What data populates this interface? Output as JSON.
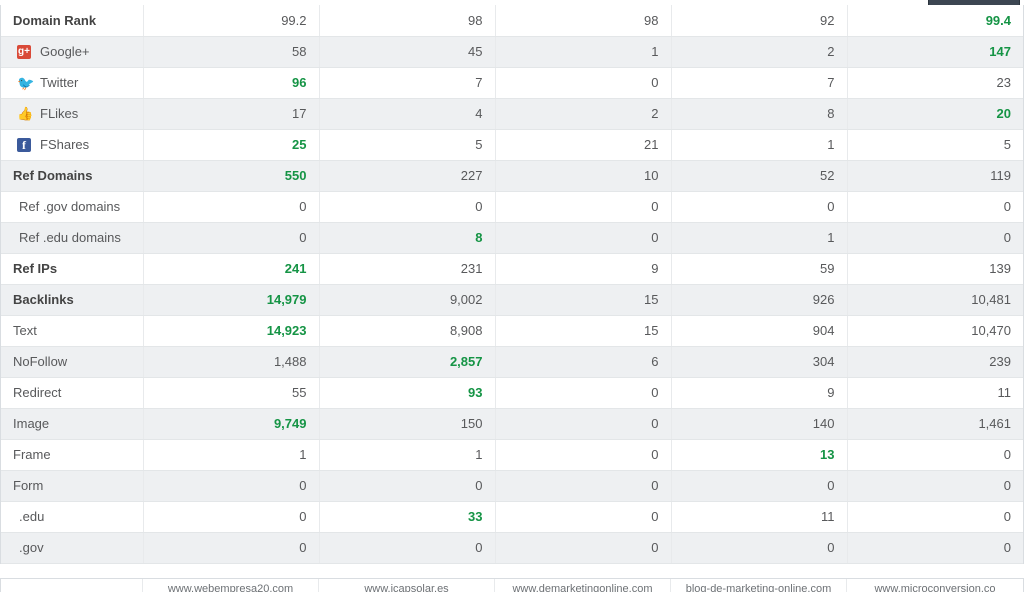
{
  "table": {
    "columns": [
      "metric",
      "site1",
      "site2",
      "site3",
      "site4",
      "site5"
    ],
    "rows": [
      {
        "label": "Domain Rank",
        "style": "head",
        "shade": false,
        "icon": null,
        "values": [
          {
            "text": "99.2",
            "green": false
          },
          {
            "text": "98",
            "green": false
          },
          {
            "text": "98",
            "green": false
          },
          {
            "text": "92",
            "green": false
          },
          {
            "text": "99.4",
            "green": true
          }
        ]
      },
      {
        "label": "Google+",
        "style": "social",
        "shade": true,
        "icon": "google-plus-icon",
        "icon_glyph": "g+",
        "values": [
          {
            "text": "58",
            "green": false
          },
          {
            "text": "45",
            "green": false
          },
          {
            "text": "1",
            "green": false
          },
          {
            "text": "2",
            "green": false
          },
          {
            "text": "147",
            "green": true
          }
        ]
      },
      {
        "label": "Twitter",
        "style": "social",
        "shade": false,
        "icon": "twitter-bird-icon",
        "icon_glyph": "ὂ6",
        "values": [
          {
            "text": "96",
            "green": true
          },
          {
            "text": "7",
            "green": false
          },
          {
            "text": "0",
            "green": false
          },
          {
            "text": "7",
            "green": false
          },
          {
            "text": "23",
            "green": false
          }
        ]
      },
      {
        "label": "FLikes",
        "style": "social",
        "shade": true,
        "icon": "thumbs-up-icon",
        "icon_glyph": "ὄD",
        "values": [
          {
            "text": "17",
            "green": false
          },
          {
            "text": "4",
            "green": false
          },
          {
            "text": "2",
            "green": false
          },
          {
            "text": "8",
            "green": false
          },
          {
            "text": "20",
            "green": true
          }
        ]
      },
      {
        "label": "FShares",
        "style": "social",
        "shade": false,
        "icon": "facebook-icon",
        "icon_glyph": "f",
        "values": [
          {
            "text": "25",
            "green": true
          },
          {
            "text": "5",
            "green": false
          },
          {
            "text": "21",
            "green": false
          },
          {
            "text": "1",
            "green": false
          },
          {
            "text": "5",
            "green": false
          }
        ]
      },
      {
        "label": "Ref Domains",
        "style": "head",
        "shade": true,
        "icon": null,
        "values": [
          {
            "text": "550",
            "green": true
          },
          {
            "text": "227",
            "green": false
          },
          {
            "text": "10",
            "green": false
          },
          {
            "text": "52",
            "green": false
          },
          {
            "text": "119",
            "green": false
          }
        ]
      },
      {
        "label": "Ref .gov domains",
        "style": "indent",
        "shade": false,
        "icon": null,
        "values": [
          {
            "text": "0",
            "green": false
          },
          {
            "text": "0",
            "green": false
          },
          {
            "text": "0",
            "green": false
          },
          {
            "text": "0",
            "green": false
          },
          {
            "text": "0",
            "green": false
          }
        ]
      },
      {
        "label": "Ref .edu domains",
        "style": "indent",
        "shade": true,
        "icon": null,
        "values": [
          {
            "text": "0",
            "green": false
          },
          {
            "text": "8",
            "green": true
          },
          {
            "text": "0",
            "green": false
          },
          {
            "text": "1",
            "green": false
          },
          {
            "text": "0",
            "green": false
          }
        ]
      },
      {
        "label": "Ref IPs",
        "style": "head",
        "shade": false,
        "icon": null,
        "values": [
          {
            "text": "241",
            "green": true
          },
          {
            "text": "231",
            "green": false
          },
          {
            "text": "9",
            "green": false
          },
          {
            "text": "59",
            "green": false
          },
          {
            "text": "139",
            "green": false
          }
        ]
      },
      {
        "label": "Backlinks",
        "style": "head",
        "shade": true,
        "icon": null,
        "values": [
          {
            "text": "14,979",
            "green": true
          },
          {
            "text": "9,002",
            "green": false
          },
          {
            "text": "15",
            "green": false
          },
          {
            "text": "926",
            "green": false
          },
          {
            "text": "10,481",
            "green": false
          }
        ]
      },
      {
        "label": "Text",
        "style": "normal",
        "shade": false,
        "icon": null,
        "values": [
          {
            "text": "14,923",
            "green": true
          },
          {
            "text": "8,908",
            "green": false
          },
          {
            "text": "15",
            "green": false
          },
          {
            "text": "904",
            "green": false
          },
          {
            "text": "10,470",
            "green": false
          }
        ]
      },
      {
        "label": "NoFollow",
        "style": "normal",
        "shade": true,
        "icon": null,
        "values": [
          {
            "text": "1,488",
            "green": false
          },
          {
            "text": "2,857",
            "green": true
          },
          {
            "text": "6",
            "green": false
          },
          {
            "text": "304",
            "green": false
          },
          {
            "text": "239",
            "green": false
          }
        ]
      },
      {
        "label": "Redirect",
        "style": "normal",
        "shade": false,
        "icon": null,
        "values": [
          {
            "text": "55",
            "green": false
          },
          {
            "text": "93",
            "green": true
          },
          {
            "text": "0",
            "green": false
          },
          {
            "text": "9",
            "green": false
          },
          {
            "text": "11",
            "green": false
          }
        ]
      },
      {
        "label": "Image",
        "style": "normal",
        "shade": true,
        "icon": null,
        "values": [
          {
            "text": "9,749",
            "green": true
          },
          {
            "text": "150",
            "green": false
          },
          {
            "text": "0",
            "green": false
          },
          {
            "text": "140",
            "green": false
          },
          {
            "text": "1,461",
            "green": false
          }
        ]
      },
      {
        "label": "Frame",
        "style": "normal",
        "shade": false,
        "icon": null,
        "values": [
          {
            "text": "1",
            "green": false
          },
          {
            "text": "1",
            "green": false
          },
          {
            "text": "0",
            "green": false
          },
          {
            "text": "13",
            "green": true
          },
          {
            "text": "0",
            "green": false
          }
        ]
      },
      {
        "label": "Form",
        "style": "normal",
        "shade": true,
        "icon": null,
        "values": [
          {
            "text": "0",
            "green": false
          },
          {
            "text": "0",
            "green": false
          },
          {
            "text": "0",
            "green": false
          },
          {
            "text": "0",
            "green": false
          },
          {
            "text": "0",
            "green": false
          }
        ]
      },
      {
        "label": ".edu",
        "style": "indent",
        "shade": false,
        "icon": null,
        "values": [
          {
            "text": "0",
            "green": false
          },
          {
            "text": "33",
            "green": true
          },
          {
            "text": "0",
            "green": false
          },
          {
            "text": "11",
            "green": false
          },
          {
            "text": "0",
            "green": false
          }
        ]
      },
      {
        "label": ".gov",
        "style": "indent",
        "shade": true,
        "icon": null,
        "values": [
          {
            "text": "0",
            "green": false
          },
          {
            "text": "0",
            "green": false
          },
          {
            "text": "0",
            "green": false
          },
          {
            "text": "0",
            "green": false
          },
          {
            "text": "0",
            "green": false
          }
        ]
      }
    ]
  },
  "footer_urls": [
    "",
    "www.webempresa20.com",
    "www.icapsolar.es",
    "www.demarketingonline.com",
    "blog-de-marketing-online.com",
    "www.microconversion.co"
  ],
  "colors": {
    "green_highlight": "#159445",
    "row_shade": "#eef0f2",
    "row_plain": "#ffffff",
    "text": "#58595b",
    "border": "#e3e6e8",
    "gplus_red": "#d94a38",
    "twitter_blue": "#35b0e8",
    "facebook_blue": "#3b5a9b",
    "thumb_gray": "#8d9197",
    "top_bar_dark": "#3c4652"
  }
}
